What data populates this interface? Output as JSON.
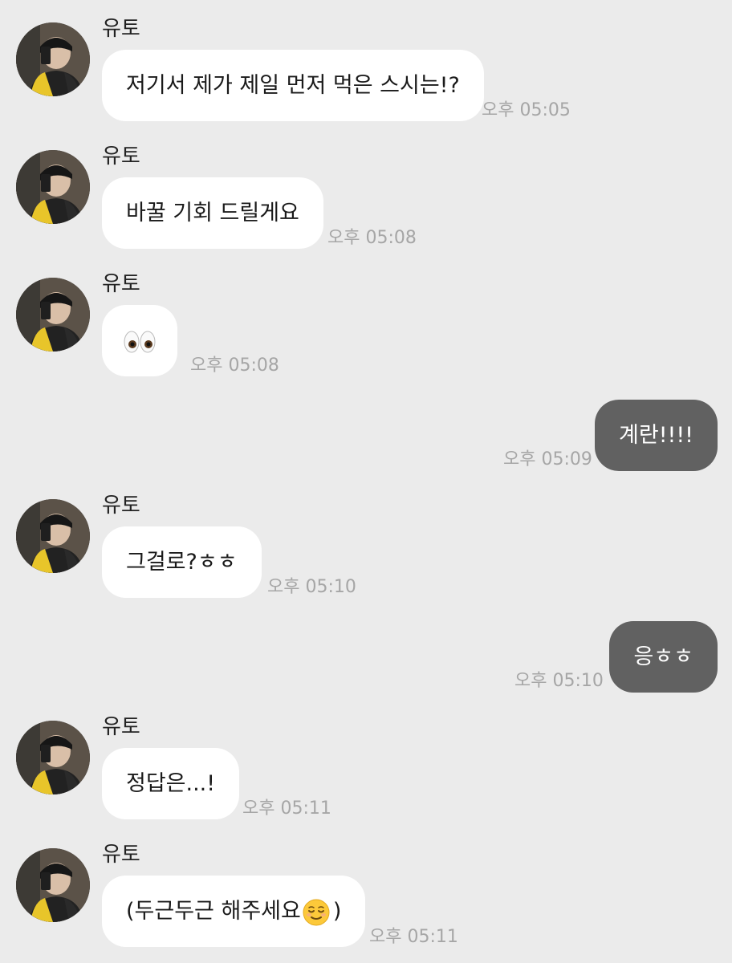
{
  "chat": {
    "messages": [
      {
        "sender": "유토",
        "text": "저기서 제가 제일 먼저 먹은 스시는!?",
        "time": "오후 05:05"
      },
      {
        "sender": "유토",
        "text": "바꿀 기회 드릴게요",
        "time": "오후 05:08"
      },
      {
        "sender": "유토",
        "text": "👀",
        "emoji": "eyes-emoji",
        "time": "오후 05:08"
      },
      {
        "sender": "me",
        "text": "계란!!!!",
        "time": "오후 05:09"
      },
      {
        "sender": "유토",
        "text": "그걸로?ㅎㅎ",
        "time": "오후 05:10"
      },
      {
        "sender": "me",
        "text": "응ㅎㅎ",
        "time": "오후 05:10"
      },
      {
        "sender": "유토",
        "text": "정답은...!",
        "time": "오후 05:11"
      },
      {
        "sender": "유토",
        "text_before": "(두근두근 해주세요",
        "emoji": "relieved-face-emoji",
        "text_after": ")",
        "time": "오후 05:11"
      }
    ]
  },
  "colors": {
    "background": "#ebebeb",
    "incoming_bubble": "#ffffff",
    "outgoing_bubble": "#616161",
    "timestamp": "#a6a6a6"
  }
}
